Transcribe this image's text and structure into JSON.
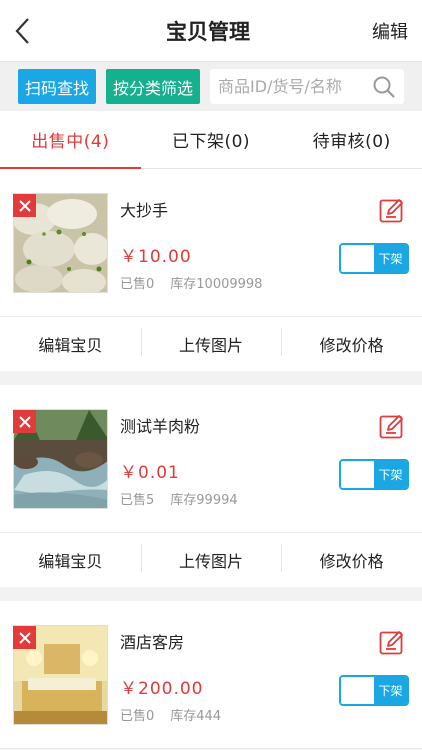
{
  "header": {
    "title": "宝贝管理",
    "edit_label": "编辑"
  },
  "toolbar": {
    "scan_label": "扫码查找",
    "filter_label": "按分类筛选",
    "search_placeholder": "商品ID/货号/名称"
  },
  "tabs": [
    {
      "label": "出售中(4)",
      "active": true
    },
    {
      "label": "已下架(0)",
      "active": false
    },
    {
      "label": "待审核(0)",
      "active": false
    }
  ],
  "products": [
    {
      "name": "大抄手",
      "price": "￥10.00",
      "sold": "已售0",
      "stock": "库存10009998",
      "toggle_label": "下架"
    },
    {
      "name": "测试羊肉粉",
      "price": "￥0.01",
      "sold": "已售5",
      "stock": "库存99994",
      "toggle_label": "下架"
    },
    {
      "name": "酒店客房",
      "price": "￥200.00",
      "sold": "已售0",
      "stock": "库存444",
      "toggle_label": "下架"
    }
  ],
  "actions": {
    "edit": "编辑宝贝",
    "upload": "上传图片",
    "price": "修改价格"
  },
  "colors": {
    "accent_red": "#e23b3b",
    "blue": "#1ba7e3",
    "green": "#15b08e"
  }
}
